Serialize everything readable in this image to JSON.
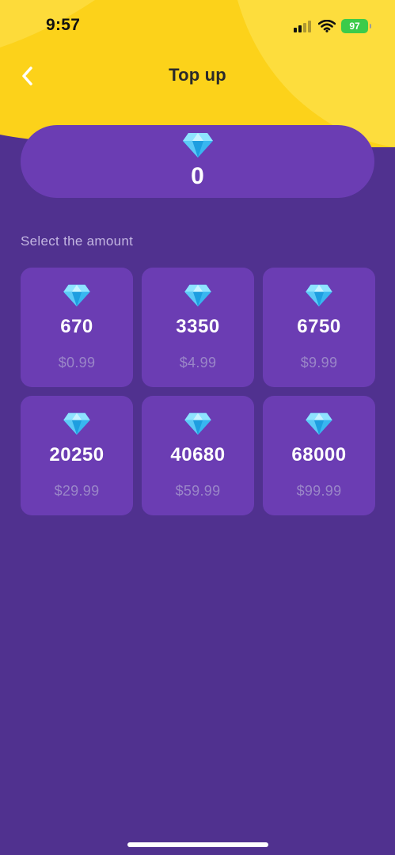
{
  "status_bar": {
    "time": "9:57",
    "battery": "97",
    "icons": [
      "signal-icon",
      "wifi-icon",
      "battery-icon"
    ]
  },
  "header": {
    "title": "Top up",
    "back_icon": "chevron-left-icon"
  },
  "balance": {
    "value": "0",
    "icon": "diamond-icon"
  },
  "packages_section": {
    "label": "Select the amount",
    "items": [
      {
        "amount": "670",
        "price": "$0.99"
      },
      {
        "amount": "3350",
        "price": "$4.99"
      },
      {
        "amount": "6750",
        "price": "$9.99"
      },
      {
        "amount": "20250",
        "price": "$29.99"
      },
      {
        "amount": "40680",
        "price": "$59.99"
      },
      {
        "amount": "68000",
        "price": "$99.99"
      }
    ]
  },
  "colors": {
    "background": "#50318f",
    "card": "#6b3db3",
    "header_yellow": "#fcd21a",
    "price_text": "#9a86c8",
    "label_text": "#c3b6e2",
    "battery": "#3ccb4a"
  }
}
